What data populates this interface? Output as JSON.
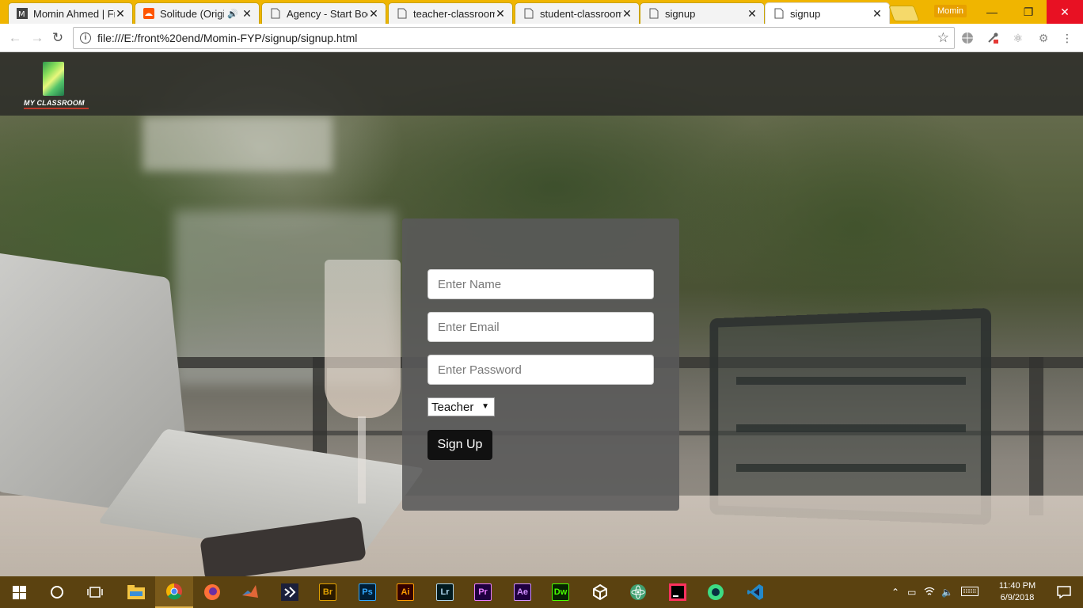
{
  "browser": {
    "tabs": [
      {
        "title": "Momin Ahmed | Fr",
        "icon": "momin-favicon-icon",
        "active": false
      },
      {
        "title": "Solitude (Origin",
        "icon": "soundcloud-icon",
        "active": false,
        "audio": "🔊"
      },
      {
        "title": "Agency - Start Boo",
        "icon": "page-icon",
        "active": false
      },
      {
        "title": "teacher-classroom",
        "icon": "page-icon",
        "active": false
      },
      {
        "title": "student-classroom",
        "icon": "page-icon",
        "active": false
      },
      {
        "title": "signup",
        "icon": "page-icon",
        "active": false
      },
      {
        "title": "signup",
        "icon": "page-icon",
        "active": true
      }
    ],
    "profile_name": "Momin",
    "address": "file:///E:/front%20end/Momin-FYP/signup/signup.html",
    "accent_color": "#f0b500"
  },
  "site": {
    "logo_text": "MY CLASSROOM"
  },
  "signup_form": {
    "name_placeholder": "Enter Name",
    "email_placeholder": "Enter Email",
    "password_placeholder": "Enter Password",
    "role_selected": "Teacher",
    "submit_label": "Sign Up"
  },
  "taskbar": {
    "apps": [
      {
        "name": "file-explorer-icon"
      },
      {
        "name": "chrome-icon",
        "active": true
      },
      {
        "name": "firefox-icon"
      },
      {
        "name": "matlab-icon"
      },
      {
        "name": "visual-studio-icon"
      },
      {
        "label": "Br",
        "name": "bridge-icon",
        "color": "#e0a000"
      },
      {
        "label": "Ps",
        "name": "photoshop-icon",
        "color": "#31a8ff"
      },
      {
        "label": "Ai",
        "name": "illustrator-icon",
        "color": "#ff9a00"
      },
      {
        "label": "Lr",
        "name": "lightroom-icon",
        "color": "#add5ec"
      },
      {
        "label": "Pr",
        "name": "premiere-icon",
        "color": "#e77bff"
      },
      {
        "label": "Ae",
        "name": "after-effects-icon",
        "color": "#d291ff"
      },
      {
        "label": "Dw",
        "name": "dreamweaver-icon",
        "color": "#4aff00"
      },
      {
        "name": "unity-icon"
      },
      {
        "name": "atom-icon"
      },
      {
        "name": "intellij-icon"
      },
      {
        "name": "android-studio-icon"
      },
      {
        "name": "vscode-icon"
      }
    ],
    "time": "11:40 PM",
    "date": "6/9/2018"
  }
}
